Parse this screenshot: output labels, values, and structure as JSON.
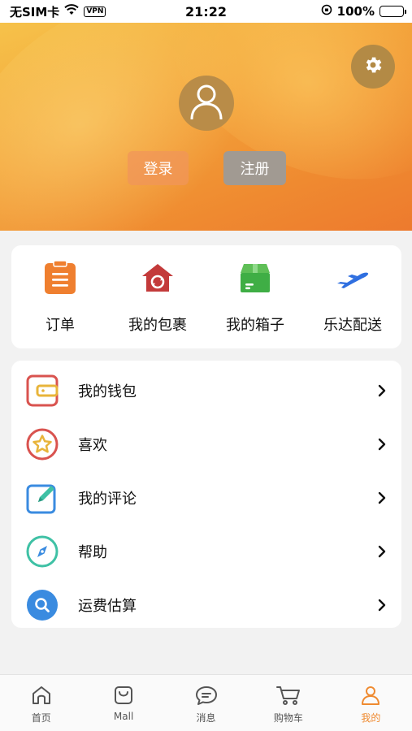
{
  "status_bar": {
    "carrier": "无SIM卡",
    "vpn": "VPN",
    "time": "21:22",
    "battery": "100%"
  },
  "header": {
    "login_label": "登录",
    "register_label": "注册"
  },
  "quick_actions": [
    {
      "label": "订单",
      "icon": "clipboard-icon"
    },
    {
      "label": "我的包裹",
      "icon": "package-home-icon"
    },
    {
      "label": "我的箱子",
      "icon": "box-icon"
    },
    {
      "label": "乐达配送",
      "icon": "airplane-icon"
    }
  ],
  "menu": [
    {
      "label": "我的钱包",
      "icon": "wallet-icon",
      "color": "#d9534f"
    },
    {
      "label": "喜欢",
      "icon": "star-icon",
      "color": "#d9534f"
    },
    {
      "label": "我的评论",
      "icon": "edit-icon",
      "color": "#3a8be0"
    },
    {
      "label": "帮助",
      "icon": "compass-icon",
      "color": "#3fc1a5"
    },
    {
      "label": "运费估算",
      "icon": "search-icon",
      "color": "#3a8be0"
    }
  ],
  "tabbar": {
    "items": [
      {
        "label": "首页",
        "icon": "home-icon"
      },
      {
        "label": "Mall",
        "icon": "shopping-bag-icon"
      },
      {
        "label": "消息",
        "icon": "chat-icon"
      },
      {
        "label": "购物车",
        "icon": "cart-icon"
      },
      {
        "label": "我的",
        "icon": "user-icon"
      }
    ],
    "active_index": 4,
    "active_color": "#ef8a30"
  },
  "colors": {
    "accent": "#ef8a30",
    "background": "#f2f2f2"
  }
}
